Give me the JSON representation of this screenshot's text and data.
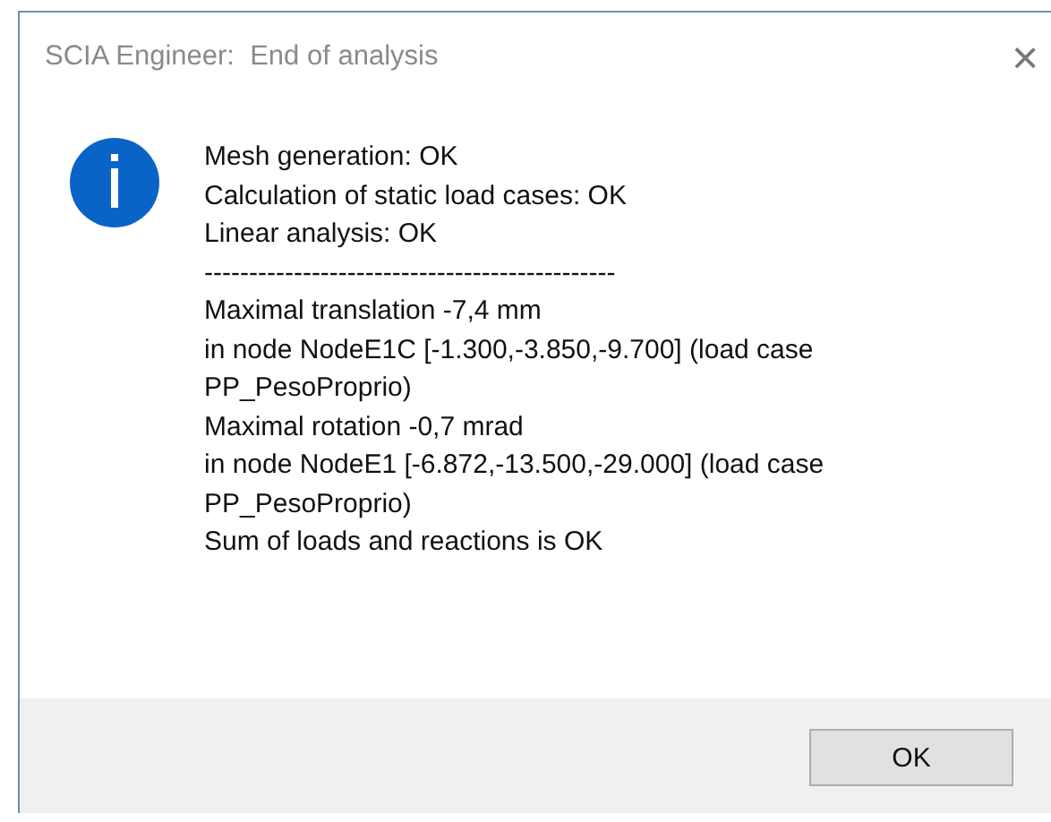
{
  "window": {
    "title": "SCIA Engineer:  End of analysis",
    "close": "×"
  },
  "message": {
    "kind": "info",
    "lines": [
      "Mesh generation: OK",
      "Calculation of static load cases: OK",
      "Linear analysis: OK",
      "----------------------------------------------",
      "Maximal translation -7,4 mm",
      "in node NodeE1C [-1.300,-3.850,-9.700] (load case",
      "PP_PesoProprio)",
      "Maximal rotation -0,7 mrad",
      "in node NodeE1 [-6.872,-13.500,-29.000] (load case",
      "PP_PesoProprio)",
      "Sum of loads and reactions is OK"
    ]
  },
  "buttons": [
    {
      "label": "OK"
    }
  ]
}
